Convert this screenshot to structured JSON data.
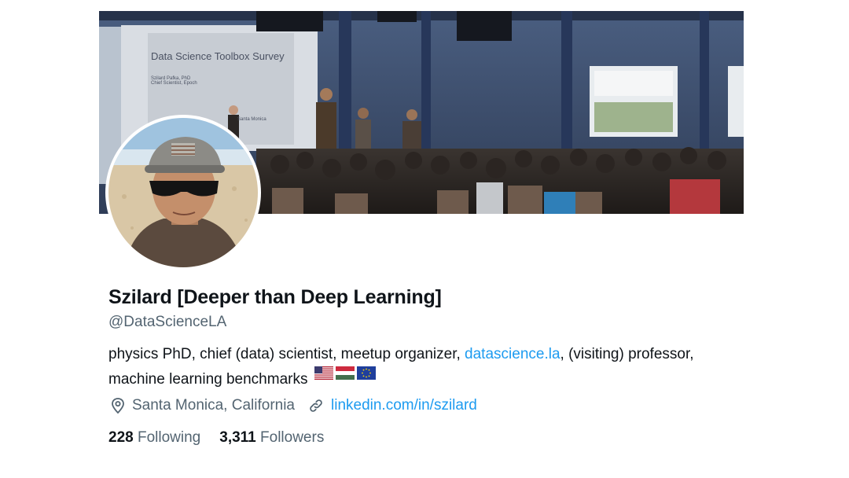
{
  "banner": {
    "slide_title": "Data Science Toolbox Survey",
    "slide_line1": "Szilard Pafka, PhD",
    "slide_line2": "Chief Scientist, Epoch",
    "slide_footer": "Santa Monica"
  },
  "profile": {
    "display_name": "Szilard [Deeper than Deep Learning]",
    "handle": "@DataScienceLA",
    "bio": {
      "before_link": "physics PhD, chief (data) scientist, meetup organizer, ",
      "link_text": "datascience.la",
      "after_link": ", (visiting) professor, machine learning benchmarks"
    },
    "flags": [
      "us-flag-icon",
      "hungary-flag-icon",
      "eu-flag-icon"
    ],
    "location": "Santa Monica, California",
    "website": "linkedin.com/in/szilard",
    "following_count": "228",
    "following_label": "Following",
    "followers_count": "3,311",
    "followers_label": "Followers"
  },
  "colors": {
    "link": "#1d9bf0",
    "secondary_text": "#536471",
    "primary_text": "#0f1419"
  }
}
